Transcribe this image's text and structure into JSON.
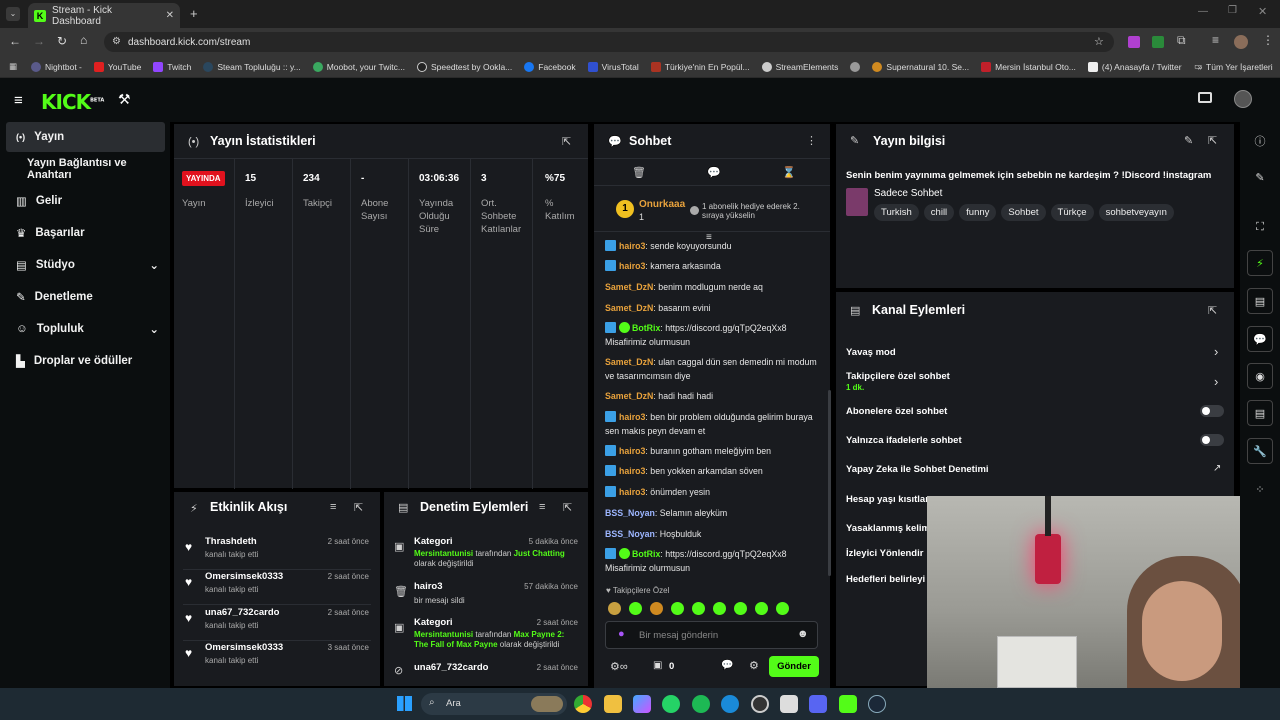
{
  "browser": {
    "tab_title": "Stream - Kick Dashboard",
    "url": "dashboard.kick.com/stream",
    "bookmarks": [
      "Nightbot -",
      "YouTube",
      "Twitch",
      "Steam Topluluğu :: y...",
      "Moobot, your Twitc...",
      "Speedtest by Ookla...",
      "Facebook",
      "VirusTotal",
      "Türkiye'nin En Popül...",
      "StreamElements",
      "",
      "Supernatural 10. Se...",
      "Mersin İstanbul Oto...",
      "(4) Anasayfa / Twitter"
    ],
    "bookmarks_folder": "Tüm Yer İşaretleri"
  },
  "header": {
    "logo": "KICK",
    "beta": "BETA"
  },
  "sidebar": {
    "items": [
      {
        "label": "Yayın"
      },
      {
        "label": "Yayın Bağlantısı ve Anahtarı"
      },
      {
        "label": "Gelir"
      },
      {
        "label": "Başarılar"
      },
      {
        "label": "Stüdyo"
      },
      {
        "label": "Denetleme"
      },
      {
        "label": "Topluluk"
      },
      {
        "label": "Droplar ve ödüller"
      }
    ]
  },
  "stats": {
    "title": "Yayın İstatistikleri",
    "live_badge": "YAYINDA",
    "live_label": "Yayın",
    "cols": [
      {
        "value": "15",
        "label": "İzleyici"
      },
      {
        "value": "234",
        "label": "Takipçi"
      },
      {
        "value": "-",
        "label": "Abone Sayısı"
      },
      {
        "value": "03:06:36",
        "label": "Yayında Olduğu Süre"
      },
      {
        "value": "3",
        "label": "Ort. Sohbete Katılanlar"
      },
      {
        "value": "%75",
        "label": "% Katılım"
      }
    ]
  },
  "chat": {
    "title": "Sohbet",
    "pinned_user": "Onurkaaa",
    "pinned_count": "1",
    "pinned_text": "1 abonelik hediye ederek 2. sıraya yükselin",
    "messages": [
      {
        "user": "hairo3",
        "text": "sende koyuyorsundu",
        "color": "#e8a23c",
        "badge": true
      },
      {
        "user": "hairo3",
        "text": "kamera arkasında",
        "color": "#e8a23c",
        "badge": true
      },
      {
        "user": "Samet_DzN",
        "text": "benim modlugum nerde aq",
        "color": "#e8a23c"
      },
      {
        "user": "Samet_DzN",
        "text": "basarım evini",
        "color": "#e8a23c"
      },
      {
        "user": "BotRix",
        "text": "https://discord.gg/qTpQ2eqXx8 Misafirimiz olurmusun",
        "color": "#53fc18",
        "badge": true,
        "bot": true
      },
      {
        "user": "Samet_DzN",
        "text": "ulan caggal dün sen demedin mi modum ve tasarımcımsın diye",
        "color": "#e8a23c"
      },
      {
        "user": "Samet_DzN",
        "text": "hadi hadi hadi",
        "color": "#e8a23c"
      },
      {
        "user": "hairo3",
        "text": "ben bir problem olduğunda gelirim buraya sen makıs peyn devam et",
        "color": "#e8a23c",
        "badge": true
      },
      {
        "user": "hairo3",
        "text": "buranın gotham meleğiyim ben",
        "color": "#e8a23c",
        "badge": true
      },
      {
        "user": "hairo3",
        "text": "ben yokken arkamdan söven",
        "color": "#e8a23c",
        "badge": true
      },
      {
        "user": "hairo3",
        "text": "önümden yesin",
        "color": "#e8a23c",
        "badge": true
      },
      {
        "user": "BSS_Noyan",
        "text": "Selamın aleyküm",
        "color": "#9db6ff"
      },
      {
        "user": "BSS_Noyan",
        "text": "Hoşbulduk",
        "color": "#9db6ff"
      },
      {
        "user": "BotRix",
        "text": "https://discord.gg/qTpQ2eqXx8 Misafirimiz olurmusun",
        "color": "#53fc18",
        "badge": true,
        "bot": true
      }
    ],
    "followers_only": "Takipçilere Özel",
    "input_placeholder": "Bir mesaj gönderin",
    "points": "0",
    "send_label": "Gönder"
  },
  "events": {
    "title": "Etkinlik Akışı",
    "rows": [
      {
        "name": "Thrashdeth",
        "sub": "kanalı takip etti",
        "time": "2 saat önce"
      },
      {
        "name": "Omersimsek0333",
        "sub": "kanalı takip etti",
        "time": "2 saat önce"
      },
      {
        "name": "una67_732cardo",
        "sub": "kanalı takip etti",
        "time": "2 saat önce"
      },
      {
        "name": "Omersimsek0333",
        "sub": "kanalı takip etti",
        "time": "3 saat önce"
      }
    ]
  },
  "moderation": {
    "title": "Denetim Eylemleri",
    "rows": [
      {
        "name": "Kategori",
        "time": "5 dakika önce",
        "actor": "Mersintantunisi",
        "mid": " tarafından ",
        "target": "Just Chatting",
        "end": " olarak değiştirildi"
      },
      {
        "name": "hairo3",
        "time": "57 dakika önce",
        "sub": "bir mesajı sildi"
      },
      {
        "name": "Kategori",
        "time": "2 saat önce",
        "actor": "Mersintantunisi",
        "mid": " tarafından ",
        "target": "Max Payne 2: The Fall of Max Payne",
        "end": " olarak değiştirildi"
      },
      {
        "name": "una67_732cardo",
        "time": "2 saat önce"
      }
    ]
  },
  "stream_info": {
    "title": "Yayın bilgisi",
    "stream_title": "Senin benim yayınıma gelmemek için sebebin ne kardeşim ? !Discord !instagram",
    "category": "Sadece Sohbet",
    "tags": [
      "Turkish",
      "chill",
      "funny",
      "Sohbet",
      "Türkçe",
      "sohbetveyayın"
    ]
  },
  "channel_actions": {
    "title": "Kanal Eylemleri",
    "rows": [
      {
        "label": "Yavaş mod"
      },
      {
        "label": "Takipçilere özel sohbet",
        "sub": "1 dk."
      },
      {
        "label": "Abonelere özel sohbet"
      },
      {
        "label": "Yalnızca ifadelerle sohbet"
      },
      {
        "label": "Yapay Zeka ile Sohbet Denetimi"
      },
      {
        "label": "Hesap yaşı kısıtlan"
      },
      {
        "label": "Yasaklanmış kelim"
      },
      {
        "label": "İzleyici Yönlendir"
      },
      {
        "label": "Hedefleri belirleyi"
      }
    ]
  },
  "taskbar": {
    "search_label": "Ara"
  },
  "colors": {
    "accent": "#53fc18",
    "panel": "#191b1f",
    "live": "#e1121e"
  }
}
